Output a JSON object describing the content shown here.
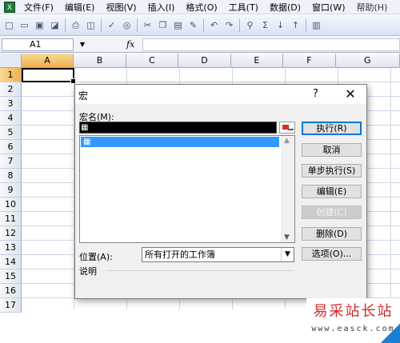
{
  "menubar": {
    "items": [
      "文件(F)",
      "编辑(E)",
      "视图(V)",
      "插入(I)",
      "格式(O)",
      "工具(T)",
      "数据(D)",
      "窗口(W)",
      "帮助(H)"
    ]
  },
  "formula_bar": {
    "name_box": "A1",
    "fx_label": "fx",
    "content": ""
  },
  "grid": {
    "columns": [
      "A",
      "B",
      "C",
      "D",
      "E",
      "F",
      "G"
    ],
    "rows": [
      "1",
      "2",
      "3",
      "4",
      "5",
      "6",
      "7",
      "8",
      "9",
      "10",
      "11",
      "12",
      "13",
      "14",
      "15",
      "16",
      "17"
    ],
    "active_cell": "A1"
  },
  "dialog": {
    "title": "宏",
    "help_glyph": "?",
    "close_glyph": "✕",
    "macro_name_label": "宏名(M):",
    "macro_name_value": "",
    "selected_macro": "",
    "buttons": {
      "run": "执行(R)",
      "cancel": "取消",
      "step_into": "单步执行(S)",
      "edit": "编辑(E)",
      "create": "创建(C)",
      "delete": "删除(D)",
      "options": "选项(O)..."
    },
    "location_label": "位置(A):",
    "location_value": "所有打开的工作簿",
    "description_label": "说明"
  },
  "watermark": {
    "title": "易采站长站",
    "url": "www.easck.com"
  },
  "colors": {
    "selection": "#3399ff",
    "watermark_red": "#d12a2a",
    "default_button_border": "#0078d7"
  }
}
